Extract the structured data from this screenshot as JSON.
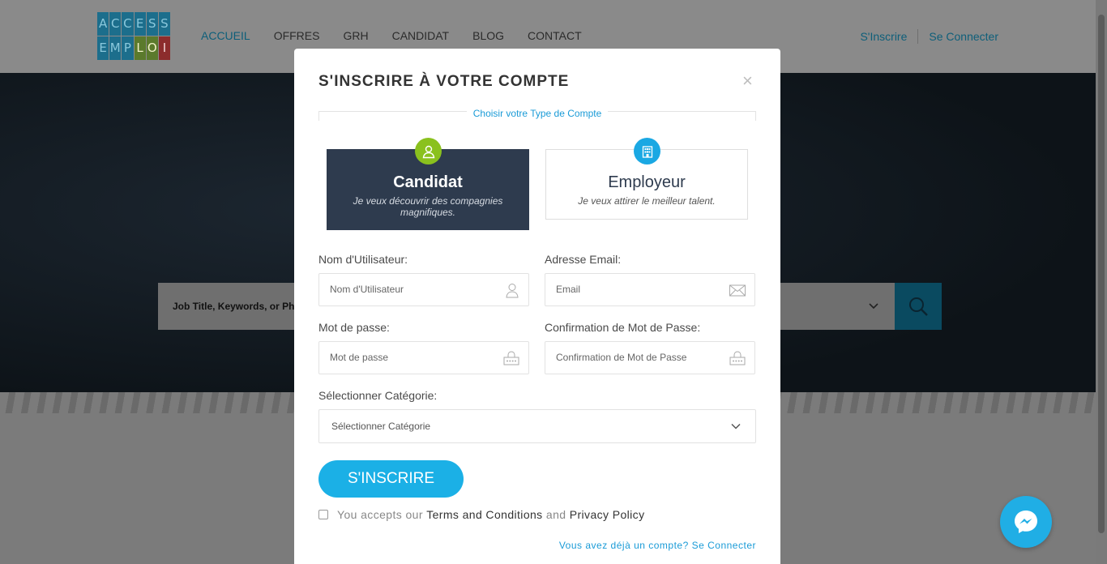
{
  "header": {
    "logo": {
      "row1": [
        "A",
        "C",
        "C",
        "E",
        "S",
        "S"
      ],
      "row2": [
        "E",
        "M",
        "P",
        "L",
        "O",
        "I"
      ]
    },
    "nav": [
      {
        "label": "ACCUEIL",
        "active": true
      },
      {
        "label": "OFFRES"
      },
      {
        "label": "GRH"
      },
      {
        "label": "CANDIDAT"
      },
      {
        "label": "BLOG"
      },
      {
        "label": "CONTACT"
      }
    ],
    "signup_label": "S'Inscrire",
    "login_label": "Se Connecter"
  },
  "hero": {
    "search_placeholder": "Job Title, Keywords, or Ph"
  },
  "modal": {
    "title": "S'INSCRIRE À VOTRE COMPTE",
    "close_icon": "×",
    "account_type_legend": "Choisir votre Type de Compte",
    "account_types": [
      {
        "title": "Candidat",
        "description": "Je veux découvrir des compagnies magnifiques.",
        "selected": true,
        "icon": "user-icon"
      },
      {
        "title": "Employeur",
        "description": "Je veux attirer le meilleur talent.",
        "selected": false,
        "icon": "building-icon"
      }
    ],
    "fields": {
      "username": {
        "label": "Nom d'Utilisateur:",
        "placeholder": "Nom d'Utilisateur"
      },
      "email": {
        "label": "Adresse Email:",
        "placeholder": "Email"
      },
      "password": {
        "label": "Mot de passe:",
        "placeholder": "Mot de passe"
      },
      "password_confirm": {
        "label": "Confirmation de Mot de Passe:",
        "placeholder": "Confirmation de Mot de Passe"
      },
      "category": {
        "label": "Sélectionner Catégorie:",
        "value": "Sélectionner Catégorie"
      }
    },
    "submit_label": "S'INSCRIRE",
    "terms": {
      "prefix": "You accepts our",
      "terms_link": "Terms and Conditions",
      "and": "and",
      "privacy_link": "Privacy Policy",
      "checked": false
    },
    "login_link": "Vous avez déjà un compte? Se Connecter"
  },
  "colors": {
    "accent": "#1bb0e6",
    "candidate_bg": "#2e3b4e",
    "candidate_icon": "#8ac11e",
    "employer_icon": "#1aa8e3"
  }
}
